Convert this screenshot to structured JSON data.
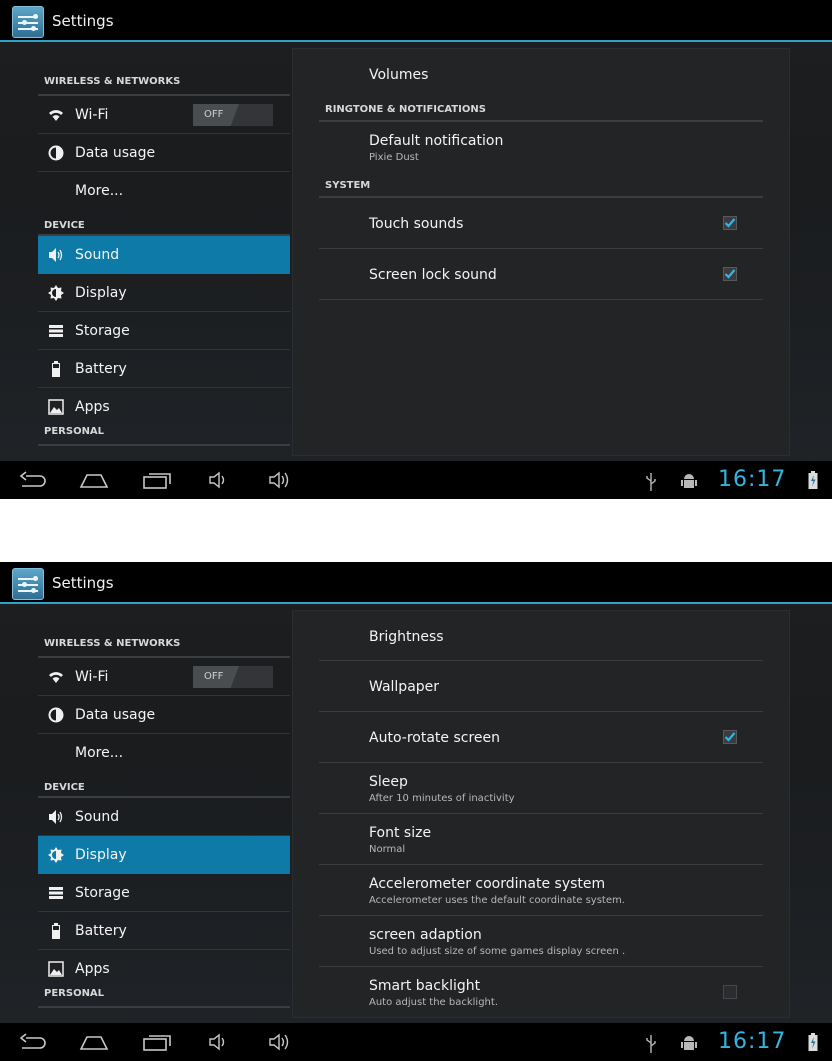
{
  "screens": [
    {
      "app_title": "Settings",
      "left": {
        "header_wireless": "WIRELESS & NETWORKS",
        "wifi_label": "Wi-Fi",
        "wifi_toggle": "OFF",
        "data_usage": "Data usage",
        "more": "More...",
        "header_device": "DEVICE",
        "sound": "Sound",
        "display": "Display",
        "storage": "Storage",
        "battery": "Battery",
        "apps": "Apps",
        "header_personal": "PERSONAL",
        "selected": "Sound"
      },
      "right": {
        "volumes": "Volumes",
        "header_ringtone": "RINGTONE & NOTIFICATIONS",
        "default_notification": "Default notification",
        "default_notification_value": "Pixie Dust",
        "header_system": "SYSTEM",
        "touch_sounds": "Touch sounds",
        "touch_sounds_checked": true,
        "screen_lock_sound": "Screen lock sound",
        "screen_lock_sound_checked": true
      },
      "clock": "16:17"
    },
    {
      "app_title": "Settings",
      "left": {
        "header_wireless": "WIRELESS & NETWORKS",
        "wifi_label": "Wi-Fi",
        "wifi_toggle": "OFF",
        "data_usage": "Data usage",
        "more": "More...",
        "header_device": "DEVICE",
        "sound": "Sound",
        "display": "Display",
        "storage": "Storage",
        "battery": "Battery",
        "apps": "Apps",
        "header_personal": "PERSONAL",
        "selected": "Display"
      },
      "right": {
        "brightness": "Brightness",
        "wallpaper": "Wallpaper",
        "auto_rotate": "Auto-rotate screen",
        "auto_rotate_checked": true,
        "sleep": "Sleep",
        "sleep_value": "After 10 minutes of inactivity",
        "font_size": "Font size",
        "font_size_value": "Normal",
        "accel": "Accelerometer coordinate system",
        "accel_value": "Accelerometer uses the default coordinate system.",
        "screen_adaption": "screen adaption",
        "screen_adaption_value": "Used to adjust size of some games display screen .",
        "smart_backlight": "Smart backlight",
        "smart_backlight_value": "Auto adjust the backlight.",
        "smart_backlight_checked": false
      },
      "clock": "16:17"
    }
  ],
  "colors": {
    "accent": "#2ea3c8",
    "selected_row": "#0e7aa8",
    "clock": "#35b4e0"
  },
  "icons": [
    "settings-app-icon",
    "wifi-icon",
    "data-usage-icon",
    "sound-icon",
    "display-icon",
    "storage-icon",
    "battery-icon",
    "apps-icon",
    "back-icon",
    "home-icon",
    "recents-icon",
    "volume-down-icon",
    "volume-up-icon",
    "usb-icon",
    "android-debug-icon",
    "battery-status-icon",
    "checkbox-icon"
  ]
}
